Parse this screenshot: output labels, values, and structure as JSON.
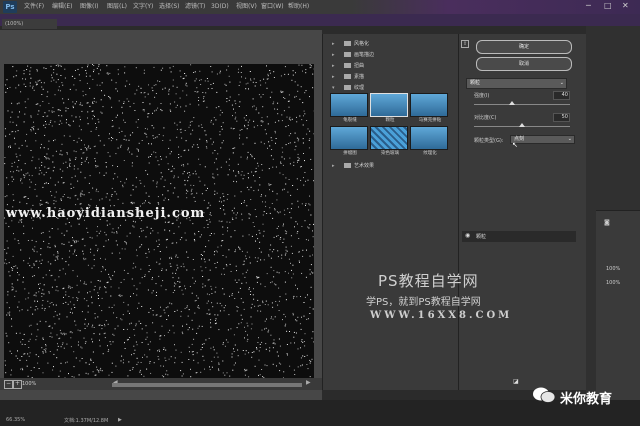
{
  "app": {
    "logo": "Ps"
  },
  "menu": [
    "文件(F)",
    "编辑(E)",
    "图像(I)",
    "图层(L)",
    "文字(Y)",
    "选择(S)",
    "滤镜(T)",
    "3D(D)",
    "视图(V)",
    "窗口(W)",
    "帮助(H)"
  ],
  "window_controls": [
    "─",
    "□",
    "✕"
  ],
  "doc_tab": "(100%)",
  "gallery": {
    "folders": [
      {
        "label": "风格化",
        "expanded": false
      },
      {
        "label": "画笔描边",
        "expanded": false
      },
      {
        "label": "扭曲",
        "expanded": false
      },
      {
        "label": "素描",
        "expanded": false
      },
      {
        "label": "纹理",
        "expanded": true
      }
    ],
    "thumbs": [
      {
        "label": "龟裂缝",
        "selected": false
      },
      {
        "label": "颗粒",
        "selected": true
      },
      {
        "label": "马赛克拼贴",
        "selected": false
      },
      {
        "label": "拼缀图",
        "selected": false
      },
      {
        "label": "染色玻璃",
        "selected": false
      },
      {
        "label": "纹理化",
        "selected": false
      }
    ],
    "art_folder": "艺术效果"
  },
  "settings": {
    "ok": "确定",
    "cancel": "取消",
    "filter_select": "颗粒",
    "intensity_label": "强度(I)",
    "intensity_value": "40",
    "intensity_fraction": 0.4,
    "contrast_label": "对比度(C)",
    "contrast_value": "50",
    "contrast_fraction": 0.5,
    "grain_type_label": "颗粒类型(G):",
    "grain_type_value": "点刻",
    "layer_item": "颗粒"
  },
  "far_right": {
    "pct1": "100%",
    "pct2": "100%"
  },
  "canvas": {
    "zoom": "100%"
  },
  "status": {
    "zoom": "66.35%",
    "doc": "文档:1.37M/12.8M"
  },
  "watermarks": {
    "site": "www.haoyidiansheji.com",
    "title": "PS教程自学网",
    "sub": "学PS，就到PS教程自学网",
    "url": "WWW.16XX8.COM",
    "brand": "米你教育"
  },
  "colors": {
    "accent_purple": "#4a2e5d",
    "panel": "#3a3a3a",
    "canvas_bg": "#0d0d0d"
  }
}
